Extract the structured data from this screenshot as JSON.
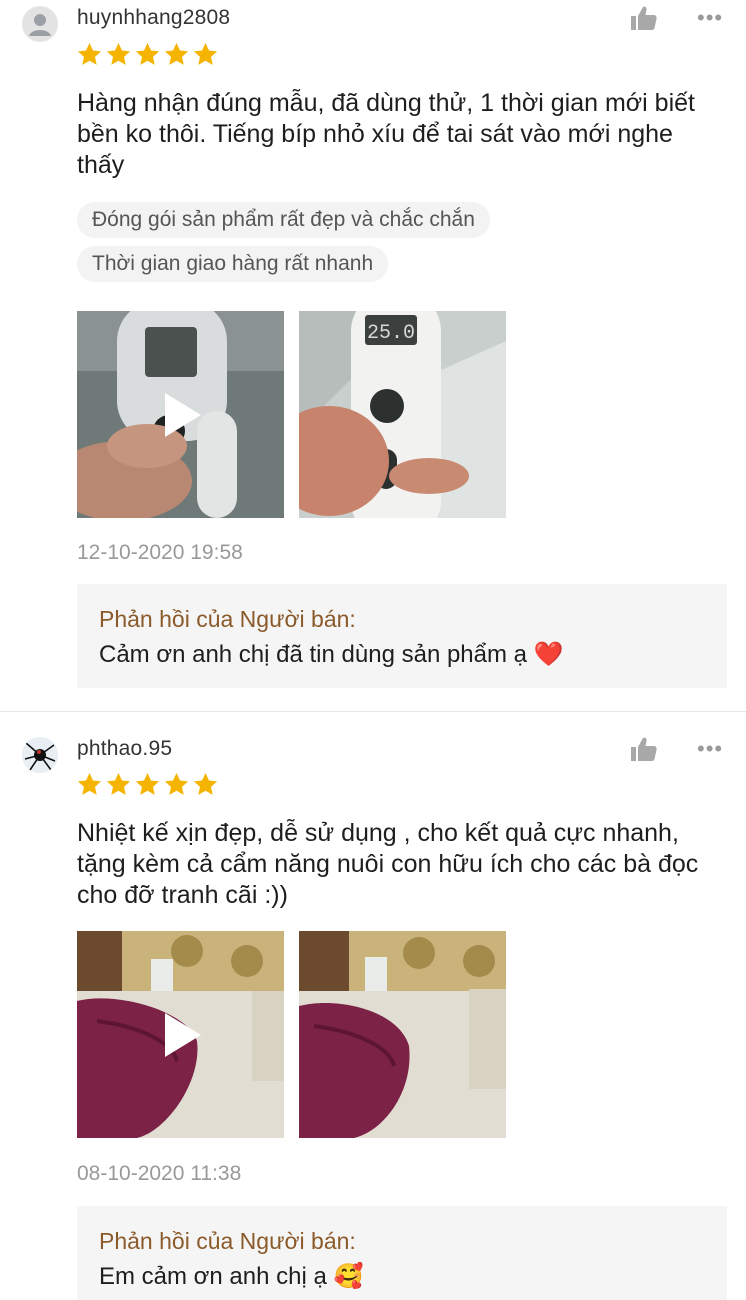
{
  "reviews": [
    {
      "username": "huynhhang2808",
      "rating": 5,
      "text": "Hàng nhận đúng mẫu, đã dùng thử, 1 thời gian mới biết bền ko thôi. Tiếng bíp nhỏ xíu để tai sát vào mới nghe thấy",
      "tags": [
        "Đóng gói sản phẩm rất đẹp và chắc chắn",
        "Thời gian giao hàng rất nhanh"
      ],
      "media": [
        "video-thumbnail",
        "photo-thumbnail"
      ],
      "timestamp": "12-10-2020 19:58",
      "seller_reply_title": "Phản hồi của Người bán:",
      "seller_reply_text": "Cảm ơn anh chị đã tin dùng sản phẩm ạ ❤️"
    },
    {
      "username": "phthao.95",
      "rating": 5,
      "text": "Nhiệt kế xịn đẹp, dễ sử dụng , cho kết quả cực nhanh, tặng kèm cả cẩm năng nuôi con hữu ích cho các bà đọc cho đỡ tranh cãi :))",
      "media": [
        "video-thumbnail",
        "photo-thumbnail"
      ],
      "timestamp": "08-10-2020 11:38",
      "seller_reply_title": "Phản hồi của Người bán:",
      "seller_reply_text": "Em cảm ơn anh chị ạ 🥰"
    }
  ],
  "thermometer_display": "25.0",
  "icons": {
    "like": "thumbs-up-icon",
    "more": "more-dots-icon",
    "star_color": "#f5b400"
  },
  "more_glyph": "•••"
}
